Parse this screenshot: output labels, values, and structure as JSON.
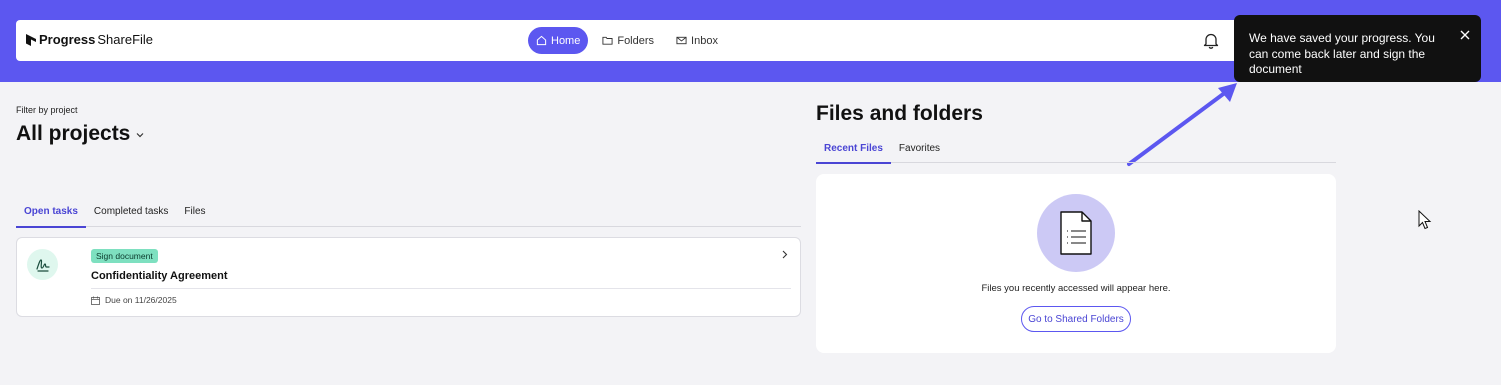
{
  "header": {
    "logo": {
      "brand_strong": "Progress",
      "brand_product": "ShareFile"
    },
    "nav": [
      {
        "label": "Home",
        "icon": "home-icon",
        "active": true
      },
      {
        "label": "Folders",
        "icon": "folder-icon",
        "active": false
      },
      {
        "label": "Inbox",
        "icon": "mail-icon",
        "active": false
      }
    ],
    "notifications_icon": "bell-icon"
  },
  "toast": {
    "message": "We have saved your progress. You can come back later and sign the document",
    "close_icon": "close-icon"
  },
  "filter": {
    "label": "Filter by project",
    "value": "All projects"
  },
  "task_tabs": [
    {
      "label": "Open tasks",
      "active": true
    },
    {
      "label": "Completed tasks",
      "active": false
    },
    {
      "label": "Files",
      "active": false
    }
  ],
  "task": {
    "badge": "Sign document",
    "title": "Confidentiality Agreement",
    "due": "Due on 11/26/2025",
    "icon": "signature-icon"
  },
  "files": {
    "title": "Files and folders",
    "tabs": [
      {
        "label": "Recent Files",
        "active": true
      },
      {
        "label": "Favorites",
        "active": false
      }
    ],
    "empty_message": "Files you recently accessed will appear here.",
    "button_label": "Go to Shared Folders"
  },
  "colors": {
    "accent": "#5c57f0",
    "toast_bg": "#111111",
    "badge_bg": "#7ee0c0",
    "page_bg": "#f3f3f6"
  }
}
